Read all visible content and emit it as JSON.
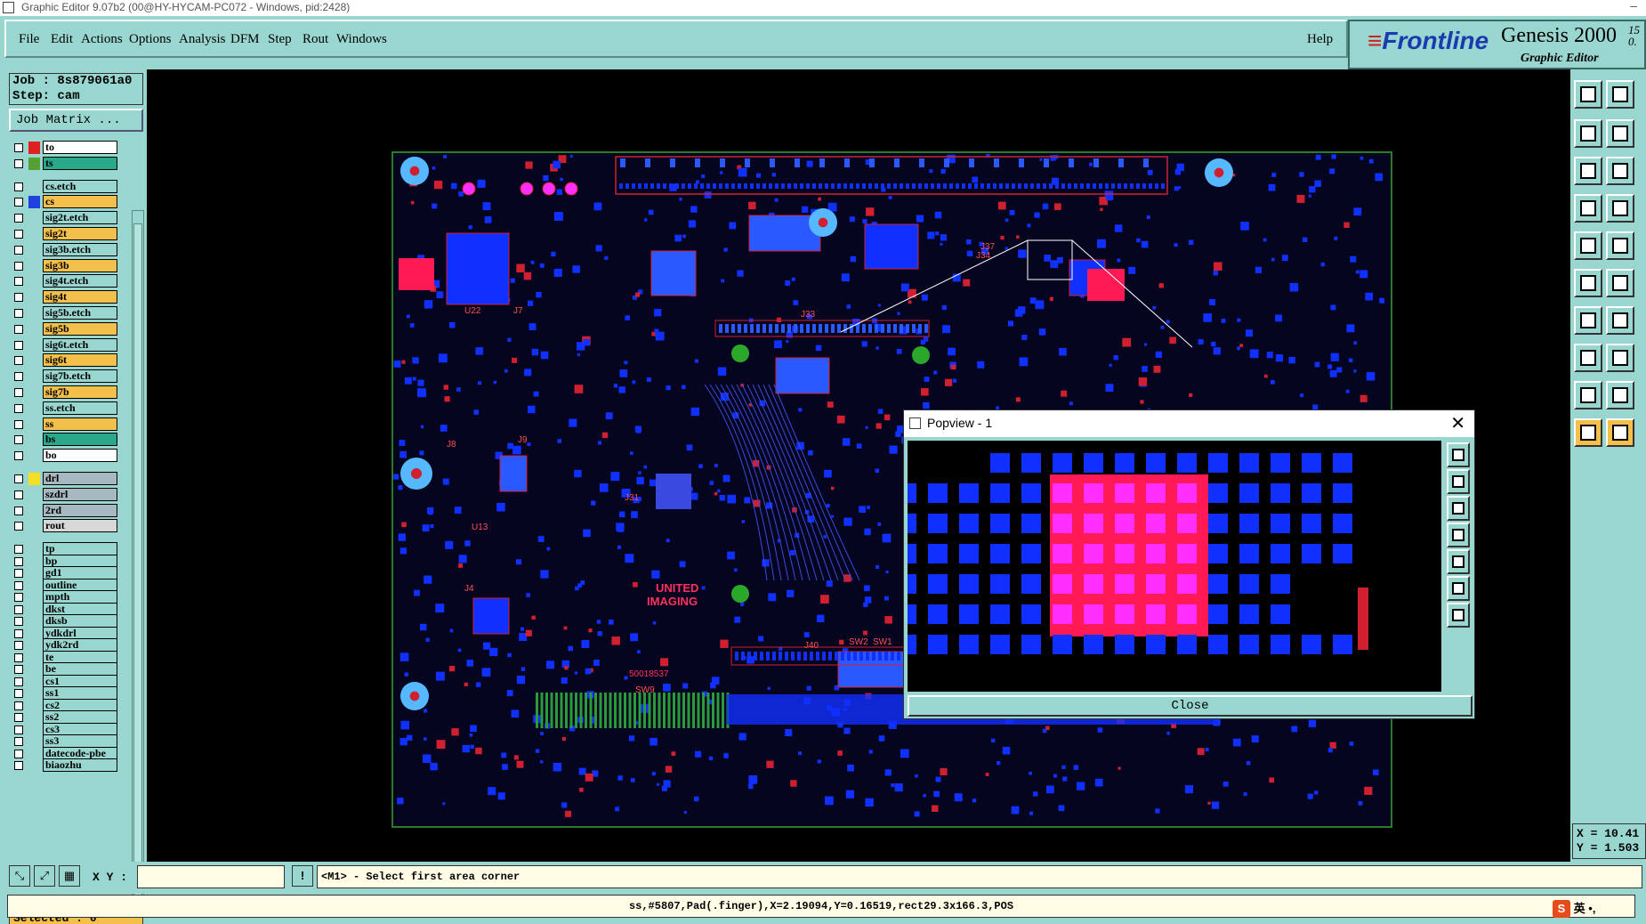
{
  "window": {
    "title": "Graphic Editor 9.07b2 (00@HY-HYCAM-PC072 - Windows, pid:2428)",
    "min_glyph": "–"
  },
  "menu": {
    "items": [
      "File",
      "Edit",
      "Actions",
      "Options",
      "Analysis",
      "DFM",
      "Step",
      "Rout",
      "Windows"
    ],
    "help": "Help"
  },
  "brand": {
    "logo": "Frontline",
    "logo_mark": "≡",
    "product": "Genesis 2000",
    "version": "15",
    "version_sub": "0.",
    "subtitle": "Graphic Editor"
  },
  "job": {
    "job_line": "Job : 8s879061a0",
    "step_line": "Step: cam",
    "matrix_button": "Job Matrix ..."
  },
  "layers": [
    {
      "name": "to",
      "color": "#ffffff",
      "swatch": "#e02020"
    },
    {
      "name": "ts",
      "color": "#2aa88a",
      "swatch": "#55a030"
    },
    {
      "name": "cs.etch",
      "color": "#9ad6d0",
      "swatch": ""
    },
    {
      "name": "cs",
      "color": "#f4c04c",
      "swatch": "#2040e0"
    },
    {
      "name": "sig2t.etch",
      "color": "#9ad6d0",
      "swatch": ""
    },
    {
      "name": "sig2t",
      "color": "#f4c04c",
      "swatch": ""
    },
    {
      "name": "sig3b.etch",
      "color": "#9ad6d0",
      "swatch": ""
    },
    {
      "name": "sig3b",
      "color": "#f4c04c",
      "swatch": ""
    },
    {
      "name": "sig4t.etch",
      "color": "#9ad6d0",
      "swatch": ""
    },
    {
      "name": "sig4t",
      "color": "#f4c04c",
      "swatch": ""
    },
    {
      "name": "sig5b.etch",
      "color": "#9ad6d0",
      "swatch": ""
    },
    {
      "name": "sig5b",
      "color": "#f4c04c",
      "swatch": ""
    },
    {
      "name": "sig6t.etch",
      "color": "#9ad6d0",
      "swatch": ""
    },
    {
      "name": "sig6t",
      "color": "#f4c04c",
      "swatch": ""
    },
    {
      "name": "sig7b.etch",
      "color": "#9ad6d0",
      "swatch": ""
    },
    {
      "name": "sig7b",
      "color": "#f4c04c",
      "swatch": ""
    },
    {
      "name": "ss.etch",
      "color": "#9ad6d0",
      "swatch": ""
    },
    {
      "name": "ss",
      "color": "#f4c04c",
      "swatch": ""
    },
    {
      "name": "bs",
      "color": "#2aa88a",
      "swatch": ""
    },
    {
      "name": "bo",
      "color": "#ffffff",
      "swatch": ""
    },
    {
      "name": "drl",
      "color": "#a8b8c0",
      "swatch": "#f4e020"
    },
    {
      "name": "szdrl",
      "color": "#a8b8c0",
      "swatch": ""
    },
    {
      "name": "2rd",
      "color": "#a8b8c0",
      "swatch": ""
    },
    {
      "name": "rout",
      "color": "#d8d8d8",
      "swatch": ""
    },
    {
      "name": "tp",
      "color": "#9ad6d0",
      "swatch": ""
    },
    {
      "name": "bp",
      "color": "#9ad6d0",
      "swatch": ""
    },
    {
      "name": "gd1",
      "color": "#9ad6d0",
      "swatch": ""
    },
    {
      "name": "outline",
      "color": "#9ad6d0",
      "swatch": ""
    },
    {
      "name": "mpth",
      "color": "#9ad6d0",
      "swatch": ""
    },
    {
      "name": "dkst",
      "color": "#9ad6d0",
      "swatch": ""
    },
    {
      "name": "dksb",
      "color": "#9ad6d0",
      "swatch": ""
    },
    {
      "name": "ydkdrl",
      "color": "#9ad6d0",
      "swatch": ""
    },
    {
      "name": "ydk2rd",
      "color": "#9ad6d0",
      "swatch": ""
    },
    {
      "name": "te",
      "color": "#9ad6d0",
      "swatch": ""
    },
    {
      "name": "be",
      "color": "#9ad6d0",
      "swatch": ""
    },
    {
      "name": "cs1",
      "color": "#9ad6d0",
      "swatch": ""
    },
    {
      "name": "ss1",
      "color": "#9ad6d0",
      "swatch": ""
    },
    {
      "name": "cs2",
      "color": "#9ad6d0",
      "swatch": ""
    },
    {
      "name": "ss2",
      "color": "#9ad6d0",
      "swatch": ""
    },
    {
      "name": "cs3",
      "color": "#9ad6d0",
      "swatch": ""
    },
    {
      "name": "ss3",
      "color": "#9ad6d0",
      "swatch": ""
    },
    {
      "name": "datecode-pbe",
      "color": "#9ad6d0",
      "swatch": ""
    },
    {
      "name": "biaozhu",
      "color": "#9ad6d0",
      "swatch": ""
    }
  ],
  "selected_count": "Selected : 0",
  "board": {
    "labels": [
      "J33",
      "J40",
      "SW1",
      "SW2",
      "SW9",
      "U22",
      "J7",
      "J8",
      "J9",
      "J31",
      "U13",
      "J34",
      "J37",
      "J4"
    ],
    "marking_1": "UNITED",
    "marking_2": "IMAGING",
    "part_number": "50018537"
  },
  "coords": {
    "x": "X = 10.41",
    "y": "Y = 1.503"
  },
  "status": {
    "xy_label": "X Y :",
    "xy_value": "",
    "prompt": "<M1> - Select first area corner",
    "warn_icon": "!"
  },
  "info_line": "ss,#5807,Pad(.finger),X=2.19094,Y=0.16519,rect29.3x166.3,POS",
  "ime": {
    "logo": "S",
    "lang": "英",
    "punct": "•,"
  },
  "popview": {
    "title": "Popview - 1",
    "close_glyph": "✕",
    "close_button": "Close"
  },
  "colors": {
    "panel": "#9ad6d0",
    "canvas": "#000000",
    "pad_blue": "#1030ff",
    "pad_red": "#ff1a55",
    "pad_magenta": "#ff30ff",
    "trace_red": "#d02030",
    "highlight": "#f4c04c"
  }
}
